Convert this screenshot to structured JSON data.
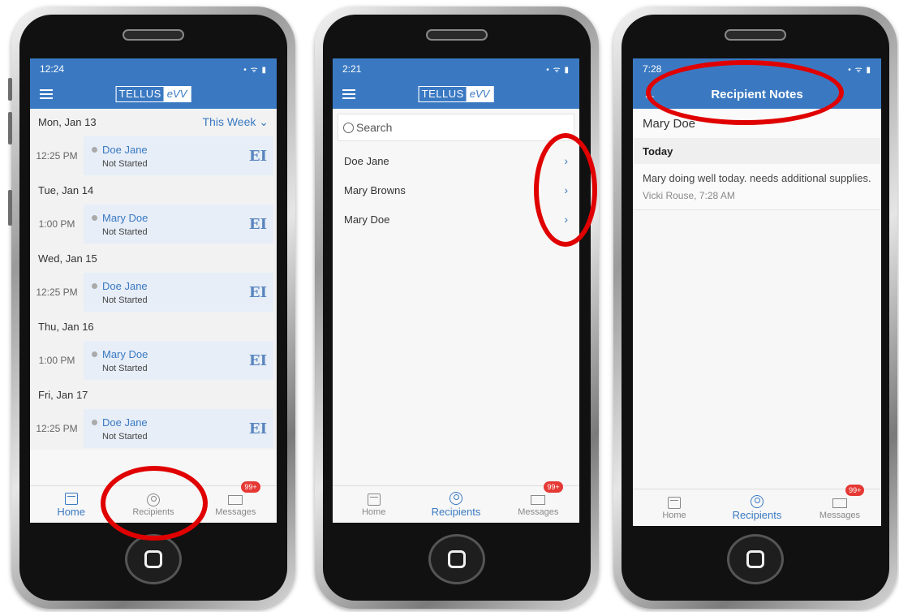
{
  "phone1": {
    "status_time": "12:24",
    "status_icons": "• ᯤ ▮",
    "logo_left": "TELLUS",
    "logo_right": "eVV",
    "filter_label": "This Week ⌄",
    "days": [
      {
        "label": "Mon, Jan 13",
        "time": "12:25 PM",
        "name": "Doe Jane",
        "status": "Not Started",
        "badge": "EI"
      },
      {
        "label": "Tue, Jan 14",
        "time": "1:00 PM",
        "name": "Mary Doe",
        "status": "Not Started",
        "badge": "EI"
      },
      {
        "label": "Wed, Jan 15",
        "time": "12:25 PM",
        "name": "Doe Jane",
        "status": "Not Started",
        "badge": "EI"
      },
      {
        "label": "Thu, Jan 16",
        "time": "1:00 PM",
        "name": "Mary Doe",
        "status": "Not Started",
        "badge": "EI"
      },
      {
        "label": "Fri, Jan 17",
        "time": "12:25 PM",
        "name": "Doe Jane",
        "status": "Not Started",
        "badge": "EI"
      }
    ]
  },
  "phone2": {
    "status_time": "2:21",
    "search_placeholder": "Search",
    "recipients": [
      "Doe Jane",
      "Mary Browns",
      "Mary Doe"
    ]
  },
  "phone3": {
    "status_time": "7:28",
    "title": "Recipient Notes",
    "recipient_name": "Mary Doe",
    "section": "Today",
    "note_text": "Mary doing well today. needs additional supplies.",
    "note_meta": "Vicki Rouse, 7:28 AM"
  },
  "tabs": {
    "home": "Home",
    "recipients": "Recipients",
    "messages": "Messages",
    "messages_badge": "99+"
  },
  "colors": {
    "accent": "#3a79c2",
    "highlight_ring": "#e00000",
    "badge": "#e53935"
  }
}
